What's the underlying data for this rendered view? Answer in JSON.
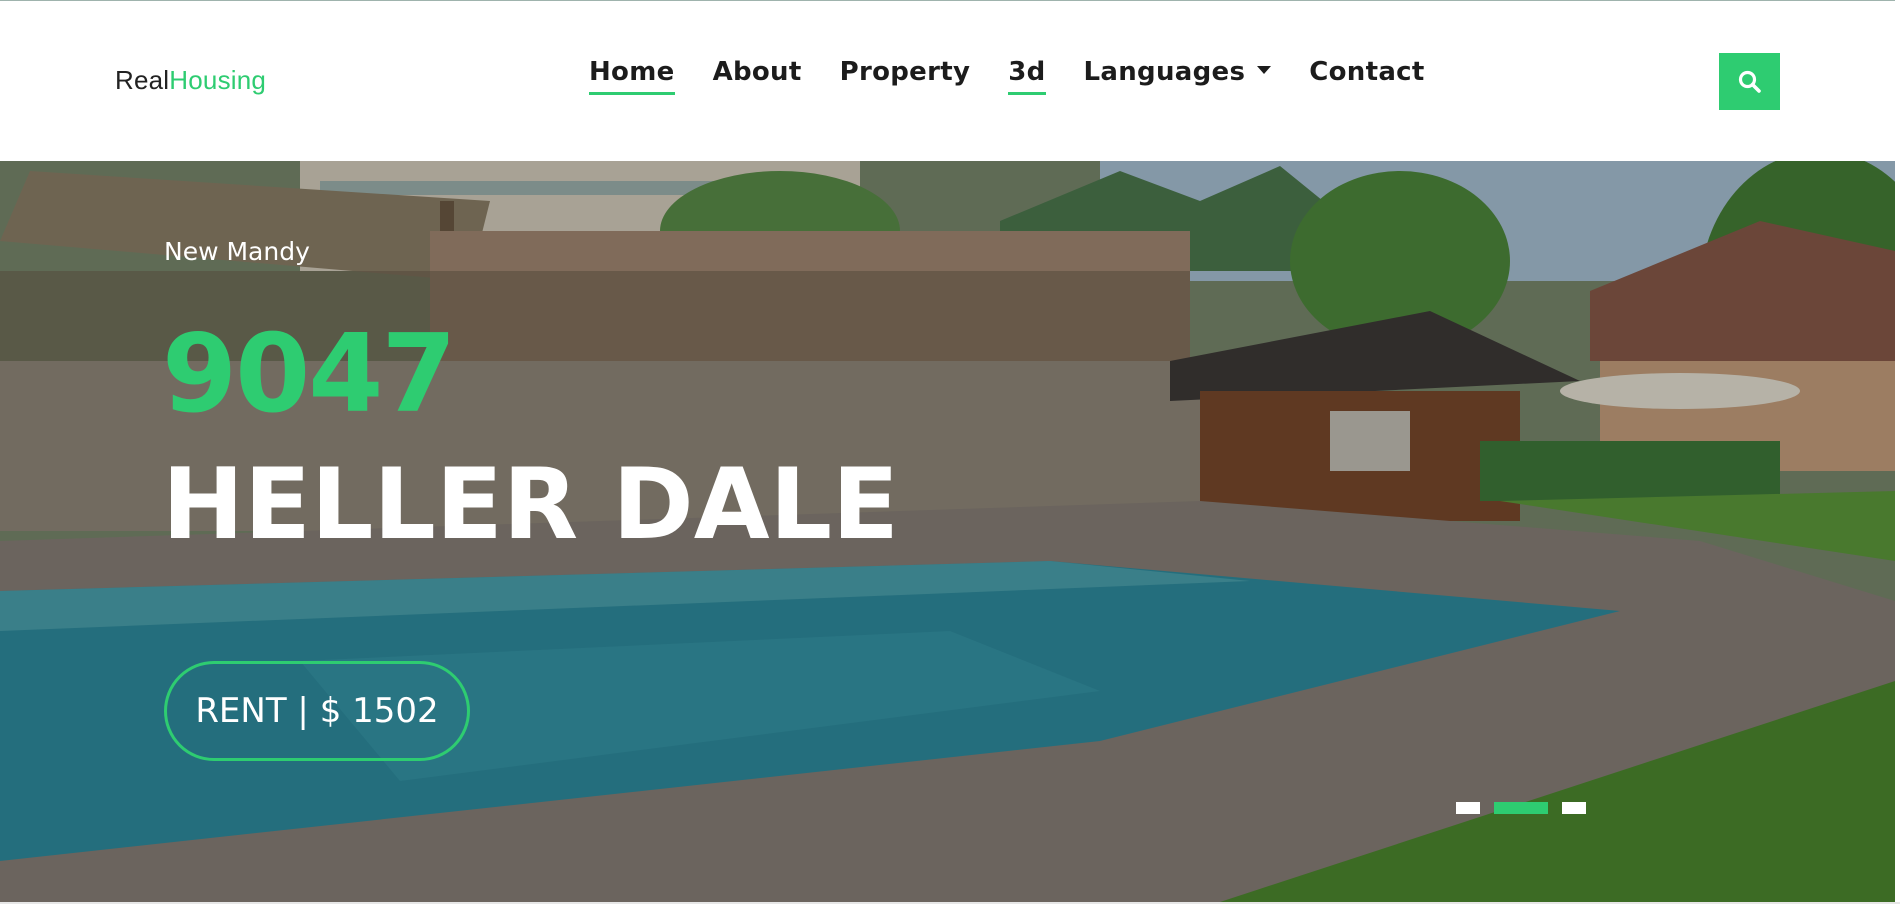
{
  "logo": {
    "prefix": "Real",
    "accent": "Housing"
  },
  "nav": {
    "items": [
      {
        "label": "Home",
        "active": true
      },
      {
        "label": "About",
        "active": false
      },
      {
        "label": "Property",
        "active": false
      },
      {
        "label": "3d",
        "active": true
      },
      {
        "label": "Languages",
        "active": false,
        "dropdown": true
      },
      {
        "label": "Contact",
        "active": false
      }
    ],
    "search_icon": "search-icon"
  },
  "hero": {
    "location": "New Mandy",
    "number": "9047",
    "street": "HELLER DALE",
    "price_label": "RENT | $ 1502",
    "slides": {
      "count": 3,
      "active_index": 1
    }
  },
  "colors": {
    "accent": "#2ecc71",
    "text_dark": "#1c1c1c",
    "white": "#ffffff"
  }
}
